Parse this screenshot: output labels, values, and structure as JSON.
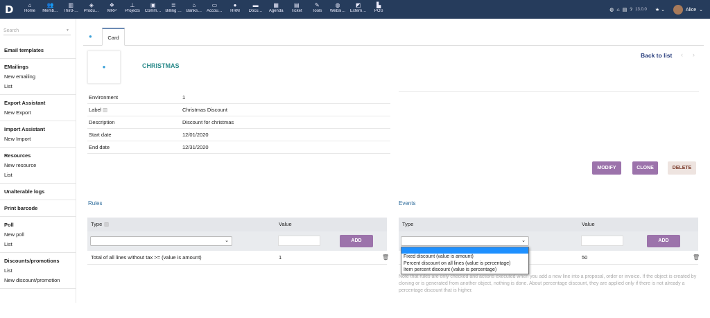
{
  "topbar": {
    "logo": "D",
    "menu": [
      {
        "label": "Home",
        "icon": "home-icon",
        "glyph": "⌂"
      },
      {
        "label": "Memb…",
        "icon": "members-icon",
        "glyph": "👥"
      },
      {
        "label": "Third-…",
        "icon": "building-icon",
        "glyph": "▥"
      },
      {
        "label": "Produ…",
        "icon": "cube-icon",
        "glyph": "◈"
      },
      {
        "label": "MRP",
        "icon": "cubes-icon",
        "glyph": "❖"
      },
      {
        "label": "Projects",
        "icon": "sitemap-icon",
        "glyph": "⊥"
      },
      {
        "label": "Comm…",
        "icon": "suitcase-icon",
        "glyph": "▣"
      },
      {
        "label": "Billing …",
        "icon": "coins-icon",
        "glyph": "≣"
      },
      {
        "label": "Banks…",
        "icon": "bank-icon",
        "glyph": "⌂"
      },
      {
        "label": "Accou…",
        "icon": "money-icon",
        "glyph": "▭"
      },
      {
        "label": "HRM",
        "icon": "user-tie-icon",
        "glyph": "●"
      },
      {
        "label": "Docu…",
        "icon": "folder-icon",
        "glyph": "▬"
      },
      {
        "label": "Agenda",
        "icon": "calendar-icon",
        "glyph": "▦"
      },
      {
        "label": "Ticket",
        "icon": "ticket-icon",
        "glyph": "▤"
      },
      {
        "label": "Tools",
        "icon": "wrench-icon",
        "glyph": "✎"
      },
      {
        "label": "Websi…",
        "icon": "globe-icon",
        "glyph": "◍"
      },
      {
        "label": "Extern…",
        "icon": "external-icon",
        "glyph": "◩"
      },
      {
        "label": "POS",
        "icon": "cash-register-icon",
        "glyph": "▙"
      }
    ],
    "version": "13.0.0",
    "user": "Alice"
  },
  "sidebar": {
    "search_placeholder": "Search",
    "sections": [
      {
        "title": "Email templates",
        "items": []
      },
      {
        "title": "EMailings",
        "items": [
          "New emailing",
          "List"
        ]
      },
      {
        "title": "Export Assistant",
        "items": [
          "New Export"
        ]
      },
      {
        "title": "Import Assistant",
        "items": [
          "New Import"
        ]
      },
      {
        "title": "Resources",
        "items": [
          "New resource",
          "List"
        ]
      },
      {
        "title": "Unalterable logs",
        "items": []
      },
      {
        "title": "Print barcode",
        "items": []
      },
      {
        "title": "Poll",
        "items": [
          "New poll",
          "List"
        ]
      },
      {
        "title": "Discounts/promotions",
        "items": [
          "List",
          "New discount/promotion"
        ]
      }
    ]
  },
  "tabs": {
    "card": "Card"
  },
  "card": {
    "ref": "CHRISTMAS",
    "back": "Back to list",
    "fields": [
      {
        "k": "Environment",
        "v": "1"
      },
      {
        "k": "Label",
        "v": "Christmas Discount"
      },
      {
        "k": "Description",
        "v": "Discount for christmas"
      },
      {
        "k": "Start date",
        "v": "12/01/2020"
      },
      {
        "k": "End date",
        "v": "12/31/2020"
      }
    ],
    "buttons": {
      "modify": "MODIFY",
      "clone": "CLONE",
      "delete": "DELETE"
    }
  },
  "rules": {
    "title": "Rules",
    "col_type": "Type",
    "col_value": "Value",
    "add": "ADD",
    "rows": [
      {
        "type": "Total of all lines without tax >= (value is amount)",
        "value": "1"
      }
    ]
  },
  "events": {
    "title": "Events",
    "col_type": "Type",
    "col_value": "Value",
    "add": "ADD",
    "rows": [
      {
        "type": "",
        "value": "50"
      }
    ],
    "options": [
      "",
      "Fixed discount (value is amount)",
      "Percent discount on all lines (value is percentage)",
      "Item percent discount (value is percentage)"
    ],
    "note": "Note that rules are only checked and actions executed when you add a new line into a proposal, order or invoice. If the object is created by cloning or is generated from another object, nothing is done. About percentage discount, they are applied only if there is not already a percentage discount that is higher."
  }
}
